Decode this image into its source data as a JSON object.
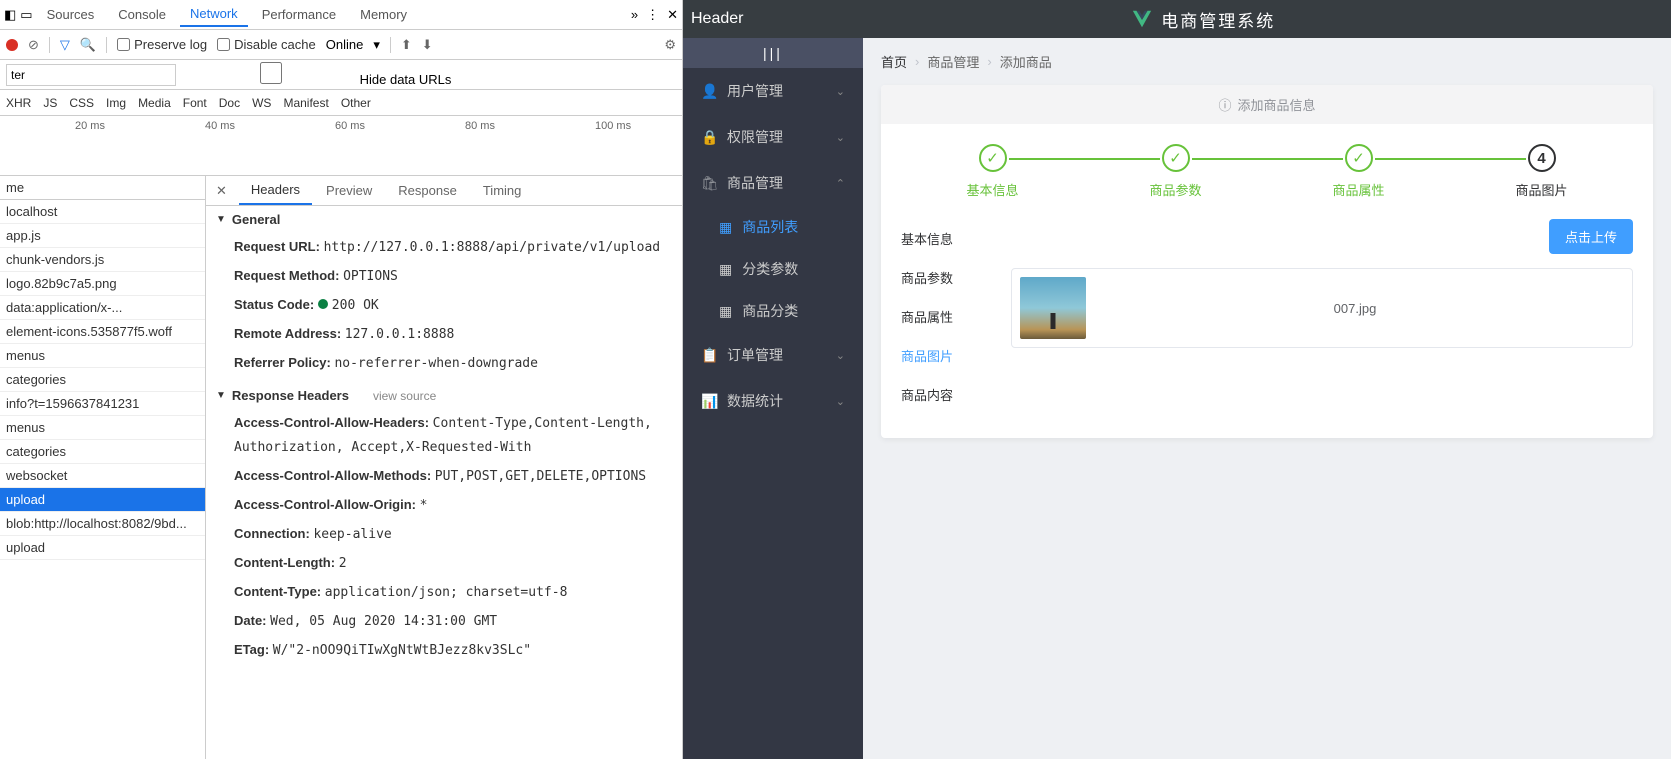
{
  "devtools": {
    "tabs": [
      "Sources",
      "Console",
      "Network",
      "Performance",
      "Memory"
    ],
    "active_tab": "Network",
    "preserve_log": "Preserve log",
    "disable_cache": "Disable cache",
    "online": "Online",
    "filter_placeholder": "ter",
    "hide_data_urls": "Hide data URLs",
    "types": [
      "XHR",
      "JS",
      "CSS",
      "Img",
      "Media",
      "Font",
      "Doc",
      "WS",
      "Manifest",
      "Other"
    ],
    "timeline_ticks": [
      "20 ms",
      "40 ms",
      "60 ms",
      "80 ms",
      "100 ms"
    ],
    "name_header": "me",
    "requests": [
      "localhost",
      "app.js",
      "chunk-vendors.js",
      "logo.82b9c7a5.png",
      "data:application/x-...",
      "element-icons.535877f5.woff",
      "menus",
      "categories",
      "info?t=1596637841231",
      "menus",
      "categories",
      "websocket",
      "upload",
      "blob:http://localhost:8082/9bd...",
      "upload"
    ],
    "selected_request": "upload",
    "detail_tabs": [
      "Headers",
      "Preview",
      "Response",
      "Timing"
    ],
    "active_detail_tab": "Headers",
    "general_title": "General",
    "general": {
      "url_k": "Request URL:",
      "url_v": "http://127.0.0.1:8888/api/private/v1/upload",
      "method_k": "Request Method:",
      "method_v": "OPTIONS",
      "status_k": "Status Code:",
      "status_v": "200 OK",
      "remote_k": "Remote Address:",
      "remote_v": "127.0.0.1:8888",
      "ref_k": "Referrer Policy:",
      "ref_v": "no-referrer-when-downgrade"
    },
    "response_headers_title": "Response Headers",
    "view_source": "view source",
    "response_headers": [
      {
        "k": "Access-Control-Allow-Headers:",
        "v": "Content-Type,Content-Length, Authorization, Accept,X-Requested-With"
      },
      {
        "k": "Access-Control-Allow-Methods:",
        "v": "PUT,POST,GET,DELETE,OPTIONS"
      },
      {
        "k": "Access-Control-Allow-Origin:",
        "v": "*"
      },
      {
        "k": "Connection:",
        "v": "keep-alive"
      },
      {
        "k": "Content-Length:",
        "v": "2"
      },
      {
        "k": "Content-Type:",
        "v": "application/json; charset=utf-8"
      },
      {
        "k": "Date:",
        "v": "Wed, 05 Aug 2020 14:31:00 GMT"
      },
      {
        "k": "ETag:",
        "v": "W/\"2-nOO9QiTIwXgNtWtBJezz8kv3SLc\""
      }
    ]
  },
  "app": {
    "header_left": "Header",
    "title": "电商管理系统",
    "sidebar": {
      "items": [
        {
          "label": "用户管理",
          "expanded": false
        },
        {
          "label": "权限管理",
          "expanded": false
        },
        {
          "label": "商品管理",
          "expanded": true,
          "children": [
            {
              "label": "商品列表",
              "active": true
            },
            {
              "label": "分类参数",
              "active": false
            },
            {
              "label": "商品分类",
              "active": false
            }
          ]
        },
        {
          "label": "订单管理",
          "expanded": false
        },
        {
          "label": "数据统计",
          "expanded": false
        }
      ]
    },
    "breadcrumb": [
      "首页",
      "商品管理",
      "添加商品"
    ],
    "alert": "添加商品信息",
    "steps": [
      {
        "label": "基本信息",
        "state": "done"
      },
      {
        "label": "商品参数",
        "state": "done"
      },
      {
        "label": "商品属性",
        "state": "done"
      },
      {
        "label": "商品图片",
        "state": "current",
        "num": "4"
      }
    ],
    "left_tabs": [
      "基本信息",
      "商品参数",
      "商品属性",
      "商品图片",
      "商品内容"
    ],
    "active_left_tab": "商品图片",
    "upload_button": "点击上传",
    "filename": "007.jpg"
  }
}
